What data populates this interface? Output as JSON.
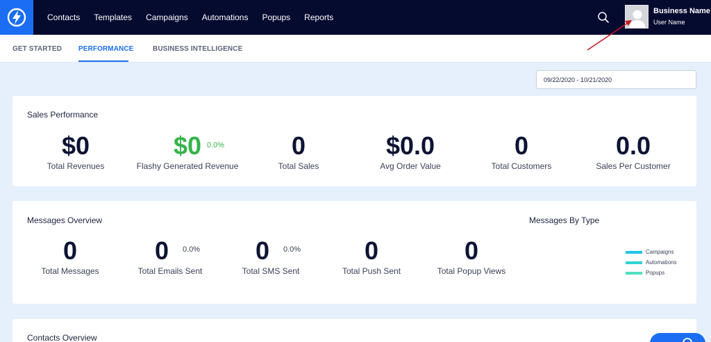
{
  "nav": {
    "items": [
      {
        "label": "Contacts"
      },
      {
        "label": "Templates"
      },
      {
        "label": "Campaigns"
      },
      {
        "label": "Automations"
      },
      {
        "label": "Popups"
      },
      {
        "label": "Reports"
      }
    ]
  },
  "user": {
    "business_name": "Business Name",
    "user_name": "User Name"
  },
  "tabs": [
    {
      "label": "GET STARTED",
      "active": false
    },
    {
      "label": "PERFORMANCE",
      "active": true
    },
    {
      "label": "BUSINESS INTELLIGENCE",
      "active": false
    }
  ],
  "date_range": "09/22/2020 - 10/21/2020",
  "sales": {
    "title": "Sales Performance",
    "metrics": [
      {
        "value": "$0",
        "label": "Total Revenues"
      },
      {
        "value": "$0",
        "label": "Flashy Generated Revenue",
        "pct": "0.0%"
      },
      {
        "value": "0",
        "label": "Total Sales"
      },
      {
        "value": "$0.0",
        "label": "Avg Order Value"
      },
      {
        "value": "0",
        "label": "Total Customers"
      },
      {
        "value": "0.0",
        "label": "Sales Per Customer"
      }
    ]
  },
  "messages": {
    "title": "Messages Overview",
    "metrics": [
      {
        "value": "0",
        "label": "Total Messages"
      },
      {
        "value": "0",
        "label": "Total Emails Sent",
        "pct": "0.0%"
      },
      {
        "value": "0",
        "label": "Total SMS Sent",
        "pct": "0.0%"
      },
      {
        "value": "0",
        "label": "Total Push Sent"
      },
      {
        "value": "0",
        "label": "Total Popup Views"
      }
    ],
    "by_type": {
      "title": "Messages By Type",
      "legend": [
        {
          "label": "Campaigns",
          "color": "#22c3e6"
        },
        {
          "label": "Automations",
          "color": "#2ed3d3"
        },
        {
          "label": "Popups",
          "color": "#4fe0c0"
        }
      ]
    }
  },
  "contacts": {
    "title": "Contacts Overview"
  },
  "colors": {
    "accent": "#1b6ef3",
    "topbar": "#050a2f",
    "positive": "#35b34a",
    "annotation": "#c4161c"
  }
}
